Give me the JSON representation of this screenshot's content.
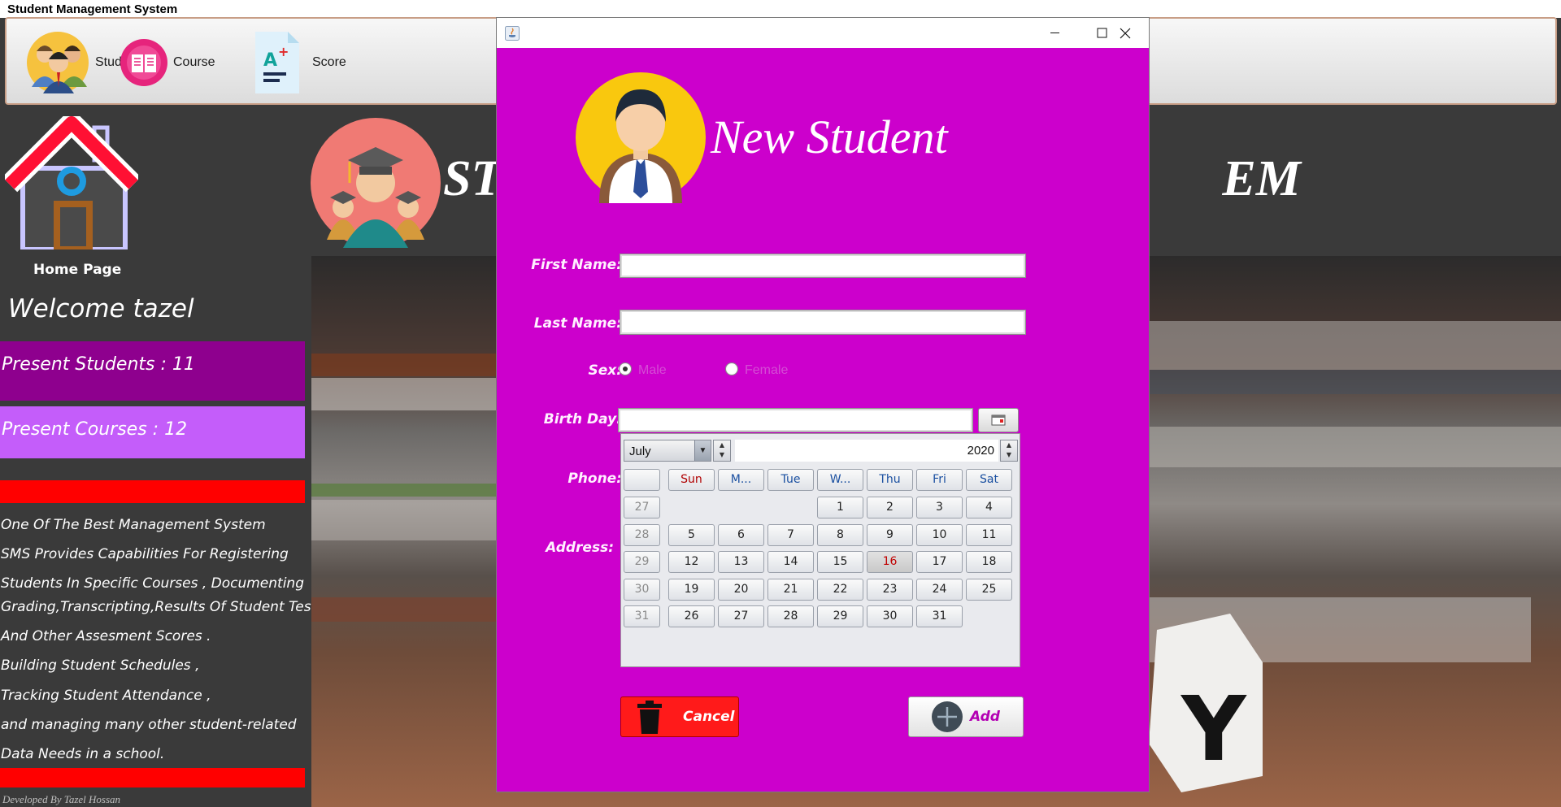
{
  "app": {
    "title": "Student Management System"
  },
  "toolbar": {
    "items": [
      {
        "label": "Student",
        "icon": "students-group-icon"
      },
      {
        "label": "Course",
        "icon": "book-icon"
      },
      {
        "label": "Score",
        "icon": "grade-paper-icon"
      }
    ]
  },
  "sidebar": {
    "home_label": "Home Page",
    "welcome": "Welcome tazel",
    "present_students": "Present Students : 11",
    "present_courses": "Present Courses : 12",
    "description_lines": [
      "One Of The Best Management System",
      "SMS Provides Capabilities For Registering",
      "Students In Specific Courses  , Documenting",
      "Grading,Transcripting,Results Of Student Tests",
      "And Other Assesment Scores .",
      " Building Student Schedules ,",
      "Tracking Student Attendance ,",
      " and managing many other student-related",
      " Data Needs in a school."
    ],
    "credit": "Developed By Tazel Hossan"
  },
  "header": {
    "title_left": "ST",
    "title_right": "EM"
  },
  "dialog": {
    "title": "New Student",
    "labels": {
      "first_name": "First Name:",
      "last_name": "Last Name:",
      "sex": "Sex:",
      "birth_day": "Birth Day:",
      "phone": "Phone:",
      "address": "Address:"
    },
    "values": {
      "first_name": "",
      "last_name": "",
      "birth_day": ""
    },
    "sex_options": [
      "Male",
      "Female"
    ],
    "sex_selected": "Male",
    "cancel_label": "Cancel",
    "add_label": "Add"
  },
  "calendar": {
    "month": "July",
    "year": "2020",
    "weekday_headers": [
      "Sun",
      "M...",
      "Tue",
      "W...",
      "Thu",
      "Fri",
      "Sat"
    ],
    "week_numbers": [
      "27",
      "28",
      "29",
      "30",
      "31"
    ],
    "weeks": [
      [
        "",
        "",
        "",
        "1",
        "2",
        "3",
        "4"
      ],
      [
        "5",
        "6",
        "7",
        "8",
        "9",
        "10",
        "11"
      ],
      [
        "12",
        "13",
        "14",
        "15",
        "16",
        "17",
        "18"
      ],
      [
        "19",
        "20",
        "21",
        "22",
        "23",
        "24",
        "25"
      ],
      [
        "26",
        "27",
        "28",
        "29",
        "30",
        "31",
        ""
      ]
    ],
    "today": "16"
  },
  "colors": {
    "dialog_bg": "#cc00cc",
    "stat_students_bg": "#8e008e",
    "stat_courses_bg": "#c45dfa",
    "accent_red": "#ff0000"
  }
}
